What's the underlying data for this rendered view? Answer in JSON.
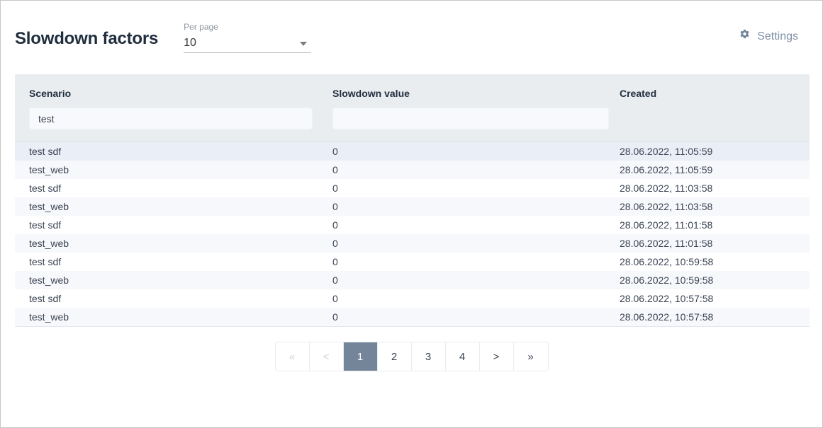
{
  "header": {
    "title": "Slowdown factors",
    "per_page": {
      "label": "Per page",
      "value": "10"
    },
    "settings": {
      "label": "Settings",
      "icon": "gear-icon"
    }
  },
  "table": {
    "columns": [
      {
        "key": "scenario",
        "label": "Scenario",
        "filter_value": "test",
        "filter_placeholder": ""
      },
      {
        "key": "slowdown_value",
        "label": "Slowdown value",
        "filter_value": "",
        "filter_placeholder": ""
      },
      {
        "key": "created",
        "label": "Created"
      }
    ],
    "rows": [
      {
        "scenario": "test sdf",
        "slowdown_value": "0",
        "created": "28.06.2022, 11:05:59"
      },
      {
        "scenario": "test_web",
        "slowdown_value": "0",
        "created": "28.06.2022, 11:05:59"
      },
      {
        "scenario": "test sdf",
        "slowdown_value": "0",
        "created": "28.06.2022, 11:03:58"
      },
      {
        "scenario": "test_web",
        "slowdown_value": "0",
        "created": "28.06.2022, 11:03:58"
      },
      {
        "scenario": "test sdf",
        "slowdown_value": "0",
        "created": "28.06.2022, 11:01:58"
      },
      {
        "scenario": "test_web",
        "slowdown_value": "0",
        "created": "28.06.2022, 11:01:58"
      },
      {
        "scenario": "test sdf",
        "slowdown_value": "0",
        "created": "28.06.2022, 10:59:58"
      },
      {
        "scenario": "test_web",
        "slowdown_value": "0",
        "created": "28.06.2022, 10:59:58"
      },
      {
        "scenario": "test sdf",
        "slowdown_value": "0",
        "created": "28.06.2022, 10:57:58"
      },
      {
        "scenario": "test_web",
        "slowdown_value": "0",
        "created": "28.06.2022, 10:57:58"
      }
    ]
  },
  "pagination": {
    "buttons": [
      {
        "label": "«",
        "name": "first-page-button",
        "state": "disabled"
      },
      {
        "label": "<",
        "name": "previous-page-button",
        "state": "disabled"
      },
      {
        "label": "1",
        "name": "page-button-1",
        "state": "active"
      },
      {
        "label": "2",
        "name": "page-button-2",
        "state": "normal"
      },
      {
        "label": "3",
        "name": "page-button-3",
        "state": "normal"
      },
      {
        "label": "4",
        "name": "page-button-4",
        "state": "normal"
      },
      {
        "label": ">",
        "name": "next-page-button",
        "state": "normal"
      },
      {
        "label": "»",
        "name": "last-page-button",
        "state": "normal"
      }
    ]
  },
  "colors": {
    "title": "#1f2d3d",
    "header_bg": "#eaedf0",
    "active_page_bg": "#74859a",
    "settings_text": "#7f91a6",
    "row_highlight": "#eaeef7",
    "row_alt": "#f7f8fc"
  }
}
